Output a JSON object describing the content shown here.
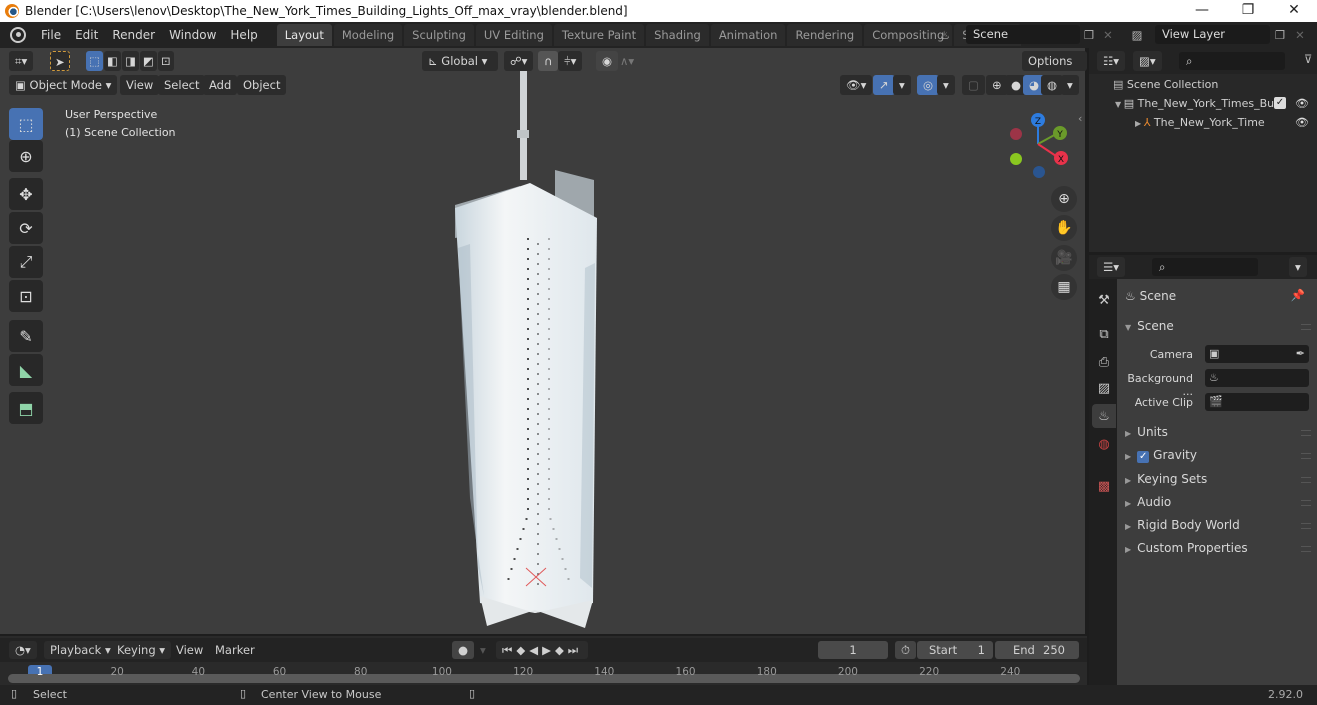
{
  "window": {
    "title": "Blender [C:\\Users\\lenov\\Desktop\\The_New_York_Times_Building_Lights_Off_max_vray\\blender.blend]",
    "controls": {
      "minimize": "—",
      "restore": "❐",
      "close": "✕"
    }
  },
  "menubar": {
    "items": [
      "File",
      "Edit",
      "Render",
      "Window",
      "Help"
    ],
    "workspaces": [
      "Layout",
      "Modeling",
      "Sculpting",
      "UV Editing",
      "Texture Paint",
      "Shading",
      "Animation",
      "Rendering",
      "Compositing",
      "Scripting"
    ],
    "active_workspace": "Layout",
    "add_workspace": "+",
    "scene": "Scene",
    "view_layer": "View Layer"
  },
  "viewport": {
    "transform_orientation": "Global",
    "options_label": "Options",
    "mode": "Object Mode",
    "menus": [
      "View",
      "Select",
      "Add",
      "Object"
    ],
    "overlay_text": [
      "User Perspective",
      "(1) Scene Collection"
    ],
    "gizmo_axes": {
      "z": "Z",
      "y": "Y",
      "x": "X"
    },
    "colors": {
      "x": "#e8324a",
      "y": "#6a9a2a",
      "z": "#2d7ce0",
      "active": "#4772b3"
    }
  },
  "tools": [
    {
      "name": "select-box",
      "glyph": "⬚"
    },
    {
      "name": "cursor",
      "glyph": "⊕"
    },
    {
      "name": "move",
      "glyph": "✥"
    },
    {
      "name": "rotate",
      "glyph": "⟳"
    },
    {
      "name": "scale",
      "glyph": "⤢"
    },
    {
      "name": "transform",
      "glyph": "⊡"
    },
    {
      "name": "annotate",
      "glyph": "✎"
    },
    {
      "name": "measure",
      "glyph": "📐"
    },
    {
      "name": "add-cube",
      "glyph": "⬒"
    }
  ],
  "outliner": {
    "root": "Scene Collection",
    "items": [
      {
        "label": "The_New_York_Times_Bu",
        "type": "collection",
        "checked": true
      },
      {
        "label": "The_New_York_Time",
        "type": "empty"
      }
    ]
  },
  "properties": {
    "header": "Scene",
    "section": "Scene",
    "fields": [
      {
        "label": "Camera",
        "value": ""
      },
      {
        "label": "Background ...",
        "value": ""
      },
      {
        "label": "Active Clip",
        "value": ""
      }
    ],
    "panels": [
      "Units",
      "Gravity",
      "Keying Sets",
      "Audio",
      "Rigid Body World",
      "Custom Properties"
    ],
    "gravity_checked": true
  },
  "timeline": {
    "menus": [
      "Playback",
      "Keying",
      "View",
      "Marker"
    ],
    "current_frame": "1",
    "start_label": "Start",
    "start": "1",
    "end_label": "End",
    "end": "250",
    "ticks": [
      "1",
      "20",
      "40",
      "60",
      "80",
      "100",
      "120",
      "140",
      "160",
      "180",
      "200",
      "220",
      "240"
    ]
  },
  "statusbar": {
    "left": "Select",
    "middle": "Center View to Mouse",
    "version": "2.92.0"
  }
}
